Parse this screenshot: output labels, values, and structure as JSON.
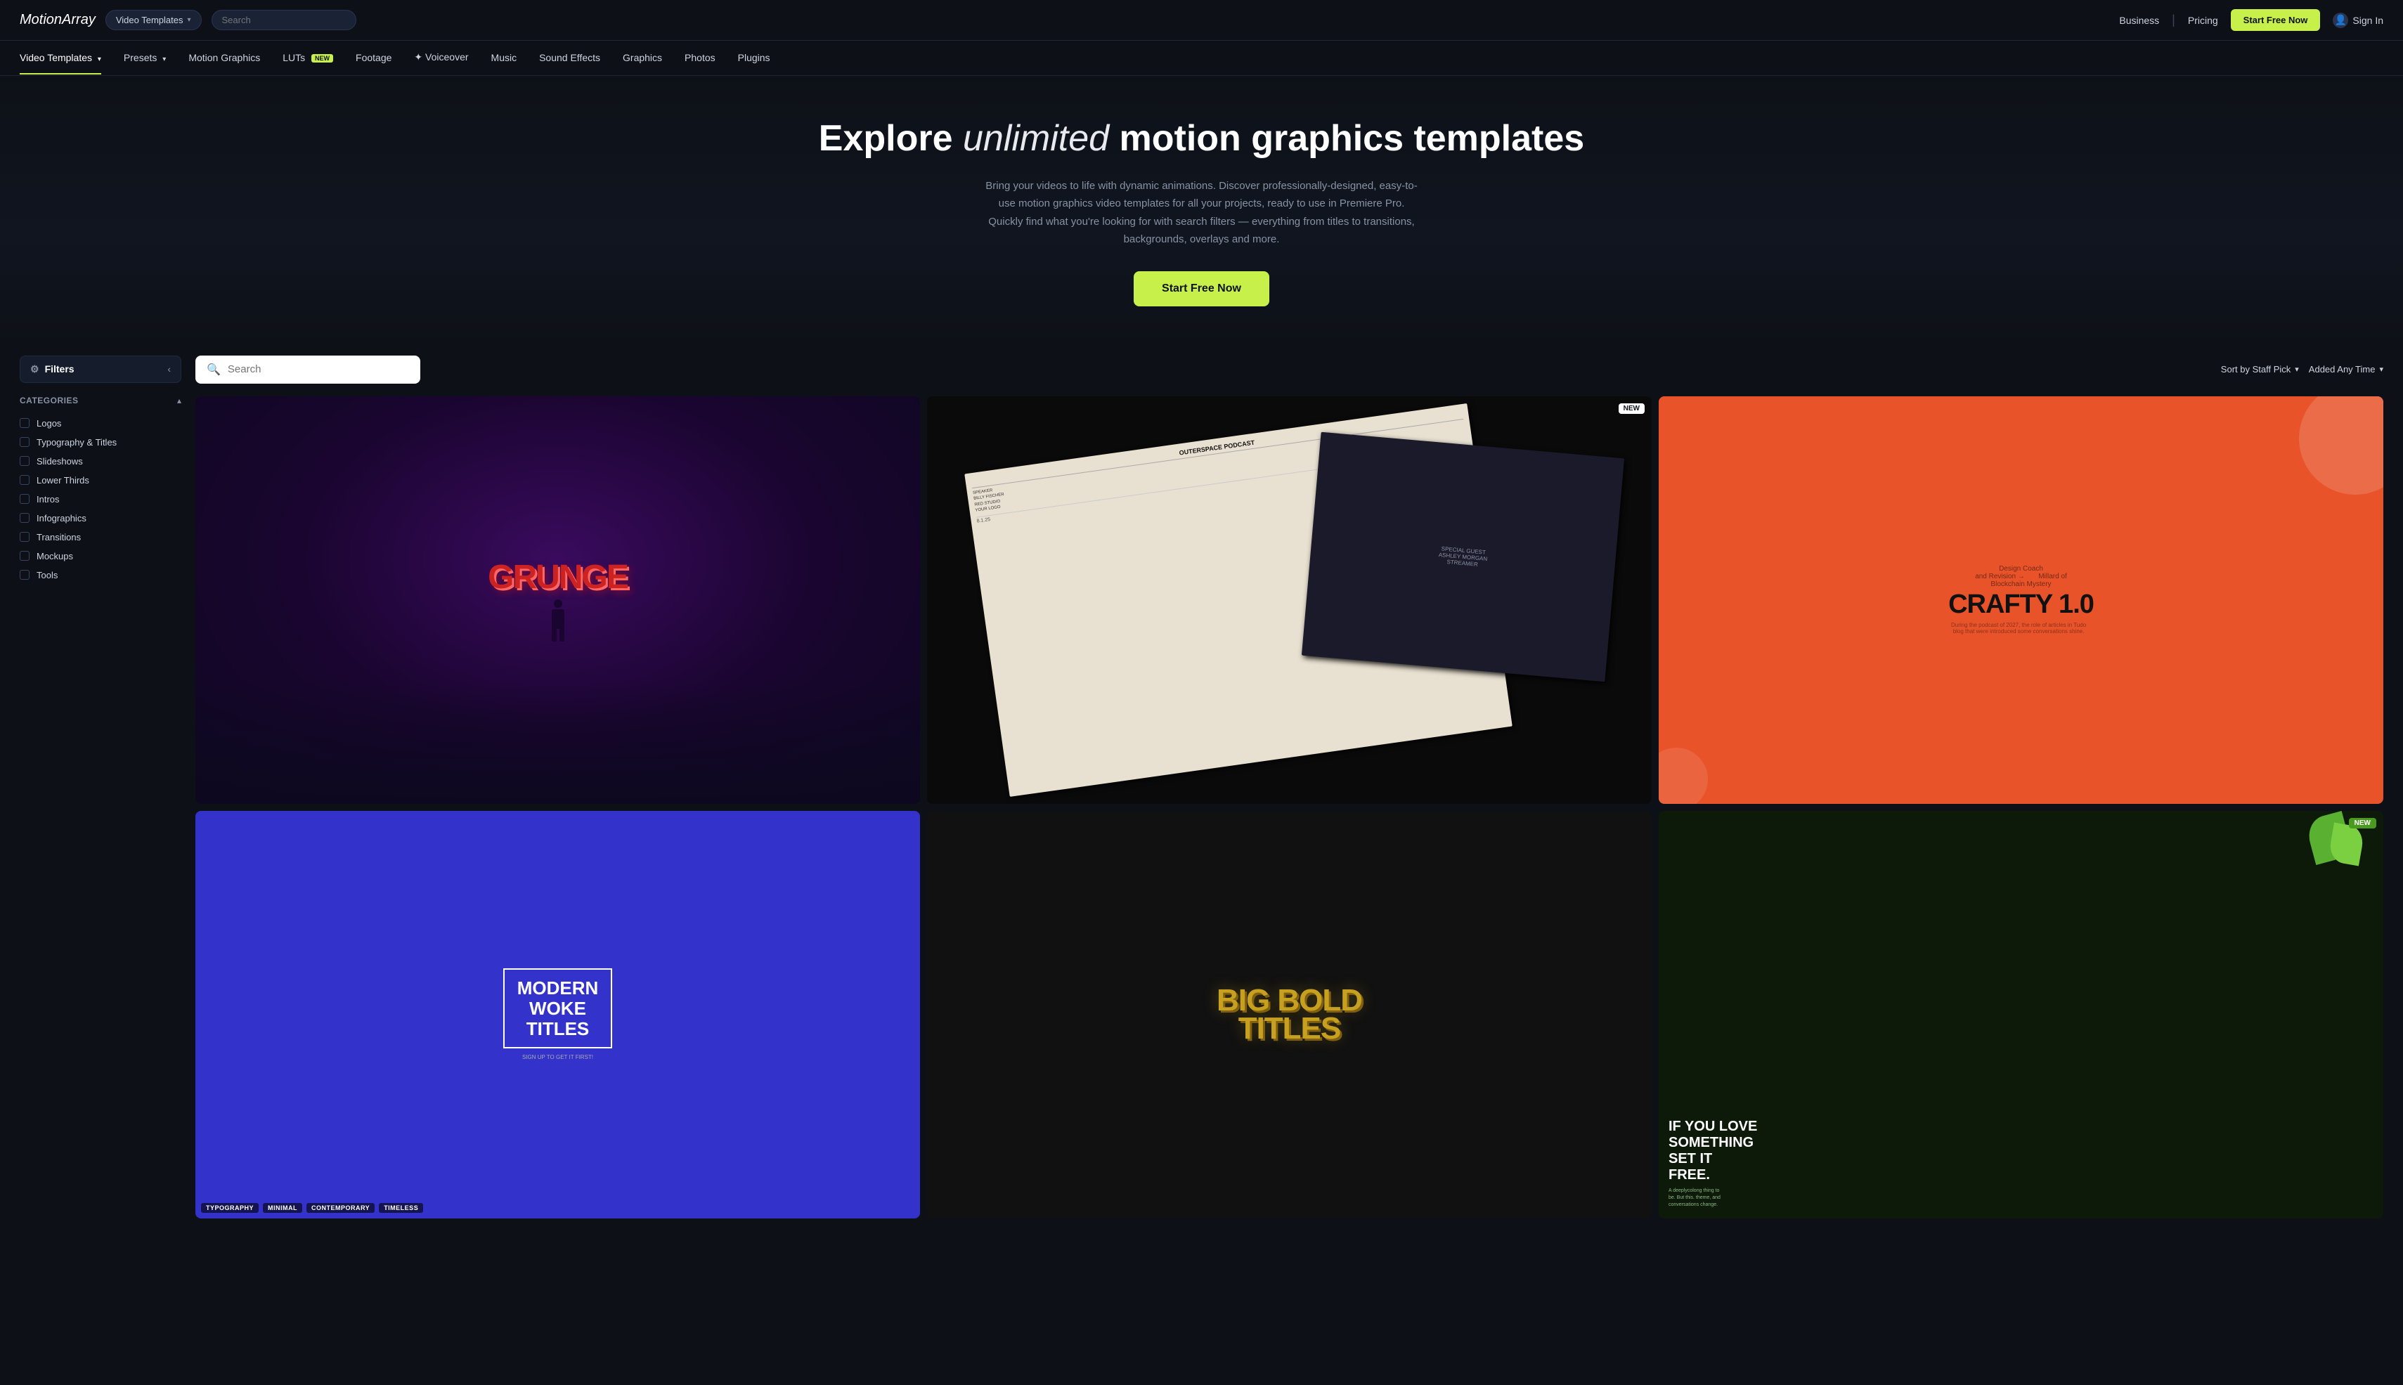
{
  "logo": {
    "brand": "Motion",
    "brand_italic": "Array"
  },
  "top_nav": {
    "video_templates_label": "Video Templates",
    "search_placeholder": "Search",
    "business_label": "Business",
    "pricing_label": "Pricing",
    "start_free_label": "Start Free Now",
    "sign_in_label": "Sign In"
  },
  "sec_nav": {
    "items": [
      {
        "id": "video-templates",
        "label": "Video Templates",
        "has_chevron": true,
        "active": true
      },
      {
        "id": "presets",
        "label": "Presets",
        "has_chevron": true,
        "active": false
      },
      {
        "id": "motion-graphics",
        "label": "Motion Graphics",
        "has_chevron": false,
        "active": false
      },
      {
        "id": "luts",
        "label": "LUTs",
        "badge": "NEW",
        "active": false
      },
      {
        "id": "footage",
        "label": "Footage",
        "has_chevron": false,
        "active": false
      },
      {
        "id": "voiceover",
        "label": "✦ Voiceover",
        "has_chevron": false,
        "active": false
      },
      {
        "id": "music",
        "label": "Music",
        "has_chevron": false,
        "active": false
      },
      {
        "id": "sound-effects",
        "label": "Sound Effects",
        "has_chevron": false,
        "active": false
      },
      {
        "id": "graphics",
        "label": "Graphics",
        "has_chevron": false,
        "active": false
      },
      {
        "id": "photos",
        "label": "Photos",
        "has_chevron": false,
        "active": false
      },
      {
        "id": "plugins",
        "label": "Plugins",
        "has_chevron": false,
        "active": false
      }
    ]
  },
  "hero": {
    "title_part1": "Explore ",
    "title_italic": "unlimited",
    "title_part2": " motion graphics templates",
    "description": "Bring your videos to life with dynamic animations. Discover professionally-designed, easy-to-use motion graphics video templates for all your projects, ready to use in Premiere Pro. Quickly find what you're looking for with search filters — everything from titles to transitions, backgrounds, overlays and more.",
    "cta_label": "Start Free Now"
  },
  "sidebar": {
    "filters_label": "Filters",
    "categories_label": "Categories",
    "categories": [
      {
        "id": "logos",
        "label": "Logos",
        "checked": false
      },
      {
        "id": "typography-titles",
        "label": "Typography & Titles",
        "checked": false
      },
      {
        "id": "slideshows",
        "label": "Slideshows",
        "checked": false
      },
      {
        "id": "lower-thirds",
        "label": "Lower Thirds",
        "checked": false
      },
      {
        "id": "intros",
        "label": "Intros",
        "checked": false
      },
      {
        "id": "infographics",
        "label": "Infographics",
        "checked": false
      },
      {
        "id": "transitions",
        "label": "Transitions",
        "checked": false
      },
      {
        "id": "mockups",
        "label": "Mockups",
        "checked": false
      },
      {
        "id": "tools",
        "label": "Tools",
        "checked": false
      }
    ]
  },
  "search": {
    "placeholder": "Search"
  },
  "sort": {
    "sort_label": "Sort by Staff Pick",
    "time_label": "Added Any Time"
  },
  "cards": [
    {
      "id": "grunge",
      "type": "grunge",
      "is_new": false,
      "tags": []
    },
    {
      "id": "podcast",
      "type": "podcast",
      "is_new": true,
      "tags": []
    },
    {
      "id": "crafty",
      "type": "crafty",
      "is_new": false,
      "tags": []
    },
    {
      "id": "modern-woke",
      "type": "modern",
      "is_new": false,
      "tags": [
        "TYPOGRAPHY",
        "MINIMAL",
        "CONTEMPORARY",
        "TIMELESS"
      ]
    },
    {
      "id": "bold-titles",
      "type": "bold",
      "is_new": false,
      "tags": []
    },
    {
      "id": "green-free",
      "type": "green",
      "is_new": true,
      "tags": []
    }
  ]
}
